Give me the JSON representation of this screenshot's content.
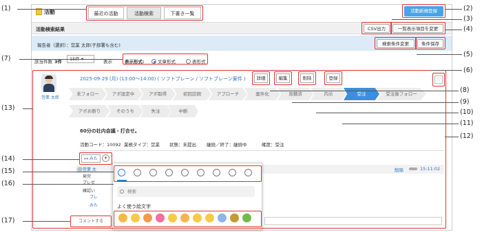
{
  "header": {
    "title": "活動",
    "tabs": [
      {
        "label": "最近の活動"
      },
      {
        "label": "活動検索"
      },
      {
        "label": "下書き一覧"
      }
    ],
    "new_button": "活動新規登録"
  },
  "search_results": {
    "title": "活動検索結果",
    "csv_button": "CSV出力",
    "columns_button": "一覧表示項目を変更",
    "reporter_label": "報告者（選択）：営業 太郎(子部署も含む)",
    "change_conditions_button": "検索条件変更",
    "save_conditions_button": "条件保存"
  },
  "list_controls": {
    "count_prefix": "該当件数",
    "count_value": "3件",
    "per_page": "15件",
    "display_label": "表示",
    "format_label": "表示形式:",
    "format_text": "文章形式",
    "format_table": "表形式"
  },
  "activity": {
    "user_name": "営業 太郎",
    "date_line": "2025-09-29 (月) (13:00～14:00) ( ソフトブレーン / ソフトブレーン案件 )",
    "actions": {
      "detail": "詳細",
      "edit": "編集",
      "delete": "削除",
      "register": "登録"
    },
    "steps_row1": [
      "未フォロー",
      "アポ設定中",
      "アポ取得",
      "初回訪問",
      "アプローチ",
      "案件化",
      "見積済",
      "内示",
      "受注",
      "受注後フォロー"
    ],
    "active_step": "受注",
    "steps_row2": [
      "アポお断り",
      "そのうち",
      "失注",
      "中断"
    ],
    "description": "60分の社内会議・打合せ。",
    "activity_code": "活動コード：10092",
    "business_type": "業務タイプ：営業",
    "status": "状態：未提出",
    "continue_end": "継続／終了：継続中",
    "certainty": "確度：受注"
  },
  "reactions": {
    "seen_label": "みたよ！",
    "add_reaction": "+"
  },
  "comment": {
    "author": "営業 太",
    "line1": "発完",
    "line2": "プレゼ",
    "line3": "確認い",
    "link1": "プレ",
    "link2": "みた",
    "delete": "削除",
    "time": "15:11:02",
    "placeholder": "コメントする"
  },
  "emoji_picker": {
    "search_placeholder": "検索",
    "frequent_heading": "よく使う絵文字"
  },
  "callouts": [
    "(1)",
    "(2)",
    "(3)",
    "(4)",
    "(5)",
    "(6)",
    "(7)",
    "(8)",
    "(9)",
    "(10)",
    "(11)",
    "(12)",
    "(13)",
    "(14)",
    "(15)",
    "(16)",
    "(17)"
  ],
  "colors": {
    "accent": "#3b8fde",
    "highlight": "#e03232",
    "link": "#2f6fbf"
  }
}
